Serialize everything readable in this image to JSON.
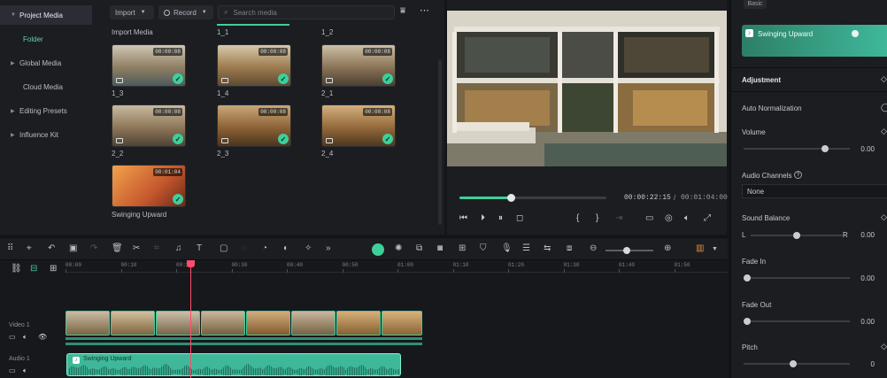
{
  "sidebar": {
    "items": [
      {
        "label": "Project Media",
        "icon": "caret-down-icon"
      },
      {
        "label": "Folder"
      },
      {
        "label": "Global Media",
        "icon": "caret-right-icon"
      },
      {
        "label": "Cloud Media"
      },
      {
        "label": "Editing Presets",
        "icon": "caret-right-icon"
      },
      {
        "label": "Influence Kit",
        "icon": "caret-right-icon"
      }
    ]
  },
  "media": {
    "import_label": "Import",
    "record_label": "Record",
    "search_placeholder": "Search media",
    "import_media_label": "Import Media",
    "top_labels": [
      "1_1",
      "1_2"
    ],
    "items": [
      {
        "label": "1_3",
        "duration": "00:00:08"
      },
      {
        "label": "1_4",
        "duration": "00:00:08"
      },
      {
        "label": "2_1",
        "duration": "00:00:08"
      },
      {
        "label": "2_2",
        "duration": "00:00:08"
      },
      {
        "label": "2_3",
        "duration": "00:00:08"
      },
      {
        "label": "2_4",
        "duration": "00:00:08"
      },
      {
        "label": "Swinging Upward",
        "duration": "00:01:04"
      }
    ]
  },
  "preview": {
    "current_time": "00:00:22:15",
    "separator": "/",
    "total_time": "00:01:04:00",
    "progress": 0.35
  },
  "properties": {
    "tab_label": "Basic",
    "audio_track_name": "Swinging Upward",
    "section_title": "Adjustment",
    "auto_normalization": "Auto Normalization",
    "volume_label": "Volume",
    "volume_value": "0.00",
    "audio_channels_label": "Audio Channels",
    "audio_channels_value": "None",
    "sound_balance_label": "Sound Balance",
    "balance_left": "L",
    "balance_right": "R",
    "balance_value": "0.00",
    "fade_in_label": "Fade In",
    "fade_in_value": "0.00",
    "fade_out_label": "Fade Out",
    "fade_out_value": "0.00",
    "pitch_label": "Pitch",
    "pitch_value": "0"
  },
  "timeline": {
    "ticks": [
      "00:00",
      "00:10",
      "00:20",
      "00:30",
      "00:40",
      "00:50",
      "01:00",
      "01:10",
      "01:20",
      "01:30",
      "01:40",
      "01:50"
    ],
    "video_track_label": "Video 1",
    "audio_track_label": "Audio 1",
    "audio_clip_label": "Swinging Upward"
  },
  "colors": {
    "accent": "#3ecf9b",
    "playhead": "#ff4d6d",
    "audio_clip": "#3fb89a"
  }
}
